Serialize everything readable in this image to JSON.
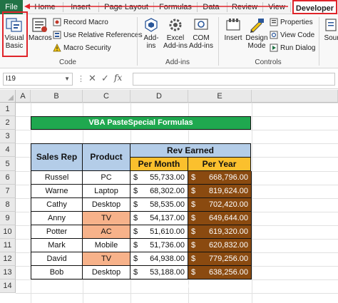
{
  "ribbon_tabs": [
    "File",
    "Home",
    "Insert",
    "Page Layout",
    "Formulas",
    "Data",
    "Review",
    "View",
    "Developer"
  ],
  "ribbon": {
    "code_group": {
      "label": "Code",
      "visual_basic_line1": "Visual",
      "visual_basic_line2": "Basic",
      "macros": "Macros",
      "record_macro": "Record Macro",
      "relative_refs": "Use Relative References",
      "macro_security": "Macro Security"
    },
    "addins_group": {
      "label": "Add-ins",
      "addins_line1": "Add-",
      "addins_line2": "ins",
      "excel_addins_line1": "Excel",
      "excel_addins_line2": "Add-ins",
      "com_addins_line1": "COM",
      "com_addins_line2": "Add-ins"
    },
    "controls_group": {
      "label": "Controls",
      "insert": "Insert",
      "design_mode_line1": "Design",
      "design_mode_line2": "Mode",
      "properties": "Properties",
      "view_code": "View Code",
      "run_dialog": "Run Dialog",
      "source": "Sour"
    }
  },
  "formula_bar": {
    "name_box": "I19",
    "fx": "fx",
    "cancel": "✕",
    "enter": "✓",
    "dots": "⋮",
    "formula": ""
  },
  "columns": [
    "A",
    "B",
    "C",
    "D",
    "E"
  ],
  "rows": [
    "1",
    "2",
    "3",
    "4",
    "5",
    "6",
    "7",
    "8",
    "9",
    "10",
    "11",
    "12",
    "13",
    "14"
  ],
  "sheet": {
    "title": "VBA PasteSpecial Formulas",
    "headers": {
      "sales_rep": "Sales Rep",
      "product": "Product",
      "rev_earned": "Rev Earned",
      "per_month": "Per Month",
      "per_year": "Per Year"
    },
    "currency": "$",
    "table_rows": [
      {
        "rep": "Russel",
        "product": "PC",
        "month": "55,733.00",
        "year": "668,796.00",
        "orange": false
      },
      {
        "rep": "Warne",
        "product": "Laptop",
        "month": "68,302.00",
        "year": "819,624.00",
        "orange": false
      },
      {
        "rep": "Cathy",
        "product": "Desktop",
        "month": "58,535.00",
        "year": "702,420.00",
        "orange": false
      },
      {
        "rep": "Anny",
        "product": "TV",
        "month": "54,137.00",
        "year": "649,644.00",
        "orange": true
      },
      {
        "rep": "Potter",
        "product": "AC",
        "month": "51,610.00",
        "year": "619,320.00",
        "orange": true
      },
      {
        "rep": "Mark",
        "product": "Mobile",
        "month": "51,736.00",
        "year": "620,832.00",
        "orange": false
      },
      {
        "rep": "David",
        "product": "TV",
        "month": "64,938.00",
        "year": "779,256.00",
        "orange": true
      },
      {
        "rep": "Bob",
        "product": "Desktop",
        "month": "53,188.00",
        "year": "638,256.00",
        "orange": false
      }
    ]
  },
  "watermark": "exceldemy",
  "colors": {
    "excel_green": "#217346",
    "title_green": "#1fa84f",
    "header_blue": "#b4cde8",
    "header_yellow": "#fbc02d",
    "highlight_orange": "#f7b28a",
    "year_brown": "#8a4a10",
    "annotation_red": "#e0242a"
  }
}
